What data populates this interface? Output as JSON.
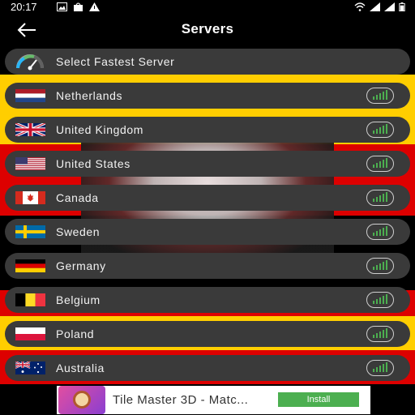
{
  "status": {
    "time": "20:17"
  },
  "header": {
    "title": "Servers"
  },
  "fastest": {
    "label": "Select Fastest Server"
  },
  "servers": [
    {
      "label": "Netherlands"
    },
    {
      "label": "United Kingdom"
    },
    {
      "label": "United States"
    },
    {
      "label": "Canada"
    },
    {
      "label": "Sweden"
    },
    {
      "label": "Germany"
    },
    {
      "label": "Belgium"
    },
    {
      "label": "Poland"
    },
    {
      "label": "Australia"
    }
  ],
  "ad": {
    "title": "Tile Master 3D - Matc...",
    "install_label": "Install"
  },
  "colors": {
    "row_bg": "#3a3a3a",
    "signal_green": "#4caf50",
    "band_red": "#dd0000",
    "band_yellow": "#ffce00"
  }
}
